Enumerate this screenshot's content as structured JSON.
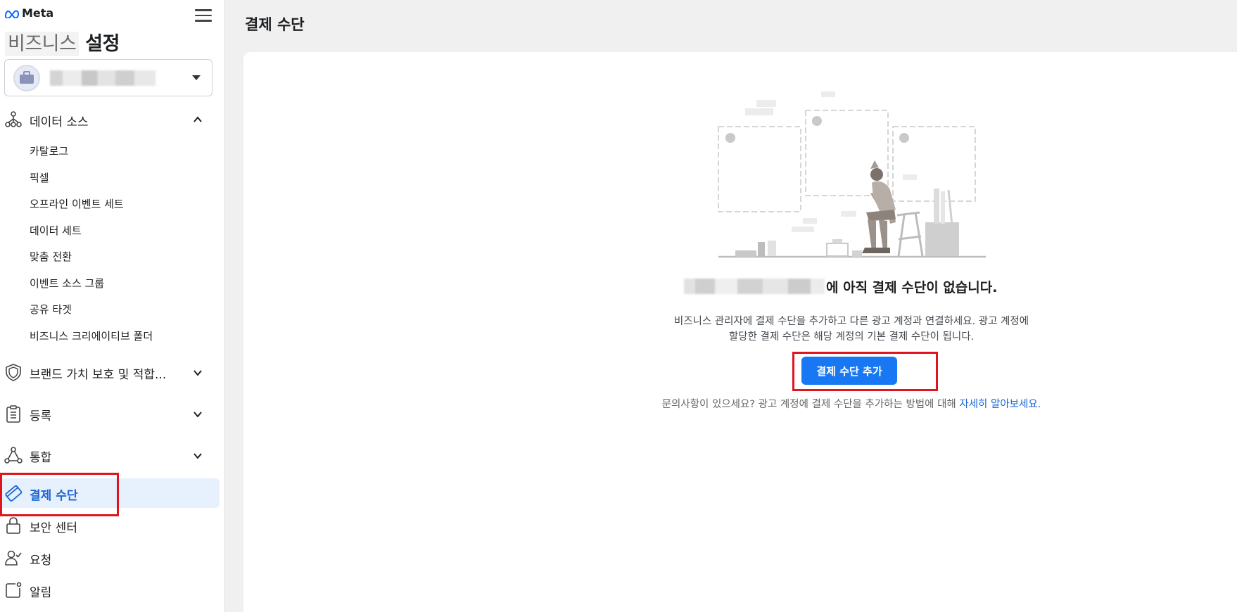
{
  "brand": {
    "name": "Meta"
  },
  "sidebar": {
    "title_blurred": "비즈니스",
    "title_suffix": "설정",
    "data_sources": {
      "label": "데이터 소스",
      "items": [
        "카탈로그",
        "픽셀",
        "오프라인 이벤트 세트",
        "데이터 세트",
        "맞춤 전환",
        "이벤트 소스 그룹",
        "공유 타겟",
        "비즈니스 크리에이티브 폴더"
      ]
    },
    "brand_safety": {
      "label": "브랜드 가치 보호 및 적합..."
    },
    "registration": {
      "label": "등록"
    },
    "integrations": {
      "label": "통합"
    },
    "payment_methods": {
      "label": "결제 수단"
    },
    "security_center": {
      "label": "보안 센터"
    },
    "requests": {
      "label": "요청"
    },
    "notifications": {
      "label": "알림"
    }
  },
  "main": {
    "page_title": "결제 수단",
    "empty_heading_suffix": "에 아직 결제 수단이 없습니다.",
    "description_line1": "비즈니스 관리자에 결제 수단을 추가하고 다른 광고 계정과 연결하세요. 광고 계정에",
    "description_line2": "할당한 결제 수단은 해당 계정의 기본 결제 수단이 됩니다.",
    "add_button": "결제 수단 추가",
    "help_text": "문의사항이 있으세요? 광고 계정에 결제 수단을 추가하는 방법에 대해",
    "help_link": "자세히 알아보세요",
    "help_period": "."
  },
  "colors": {
    "accent": "#1877f2",
    "active_bg": "#e7f0fd",
    "highlight": "#e0141e"
  },
  "icons": [
    "meta-logo-icon",
    "hamburger-menu-icon",
    "briefcase-icon",
    "caret-down-icon",
    "data-sources-icon",
    "chevron-up-icon",
    "shield-icon",
    "chevron-down-icon",
    "clipboard-icon",
    "integrations-icon",
    "credit-card-icon",
    "lock-icon",
    "person-check-icon",
    "notification-icon"
  ]
}
